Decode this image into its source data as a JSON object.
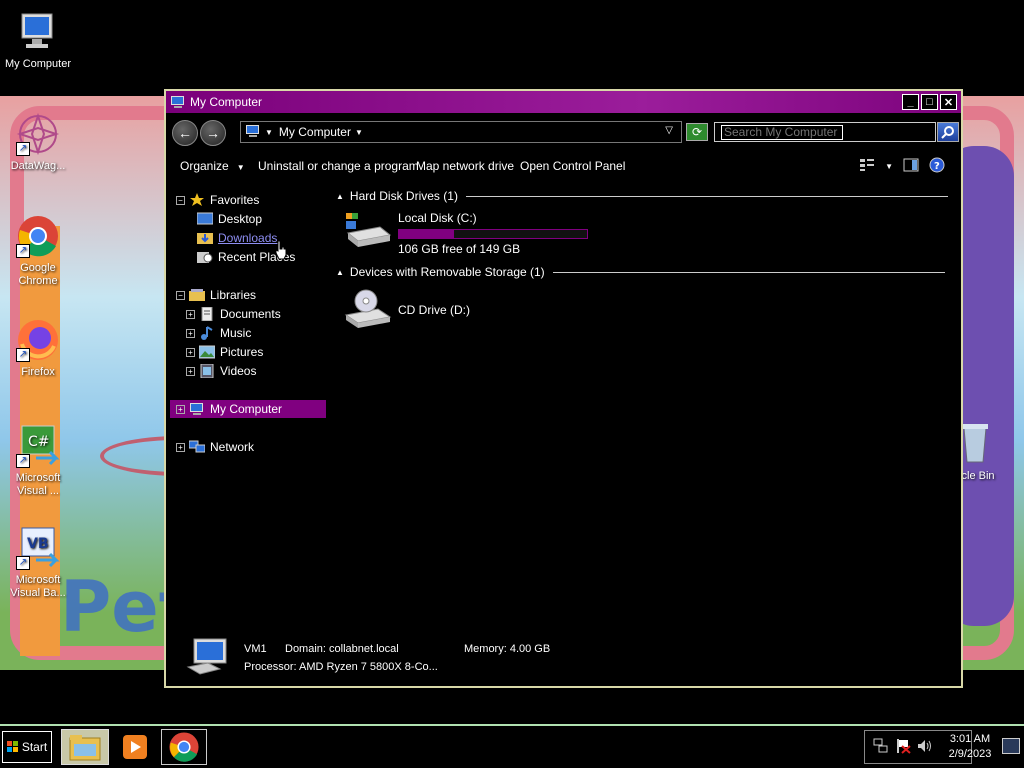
{
  "desktop": {
    "icons": [
      {
        "label": "My Computer"
      },
      {
        "label": "DataWag..."
      },
      {
        "label": "Google Chrome"
      },
      {
        "label": "Firefox"
      },
      {
        "label": "Microsoft Visual ..."
      },
      {
        "label": "Microsoft Visual Ba..."
      },
      {
        "label": "ycle Bin"
      }
    ],
    "wallpaper_text": "Pet"
  },
  "window": {
    "title": "My Computer",
    "controls": {
      "minimize": "_",
      "maximize": "□",
      "close": "✕"
    },
    "address": {
      "crumb": "My Computer"
    },
    "search": {
      "placeholder": "Search My Computer"
    },
    "toolbar": {
      "organize": "Organize",
      "uninstall": "Uninstall or change a program",
      "map_drive": "Map network drive",
      "control_panel": "Open Control Panel"
    },
    "nav": {
      "favorites": "Favorites",
      "desktop": "Desktop",
      "downloads": "Downloads",
      "recent_places": "Recent Places",
      "libraries": "Libraries",
      "documents": "Documents",
      "music": "Music",
      "pictures": "Pictures",
      "videos": "Videos",
      "my_computer": "My Computer",
      "network": "Network"
    },
    "content": {
      "hdd_group": "Hard Disk Drives (1)",
      "local_disk": {
        "name": "Local Disk (C:)",
        "free": "106 GB free of 149 GB",
        "used_fraction": 0.29
      },
      "removable_group": "Devices with Removable Storage (1)",
      "cd_drive": {
        "name": "CD Drive (D:)"
      }
    },
    "details": {
      "name": "VM1",
      "domain": "Domain: collabnet.local",
      "memory": "Memory: 4.00 GB",
      "processor": "Processor: AMD Ryzen 7 5800X 8-Co..."
    }
  },
  "taskbar": {
    "start": "Start",
    "time": "3:01 AM",
    "date": "2/9/2023"
  },
  "colors": {
    "accent": "#800080",
    "border": "#d8d8a8"
  }
}
